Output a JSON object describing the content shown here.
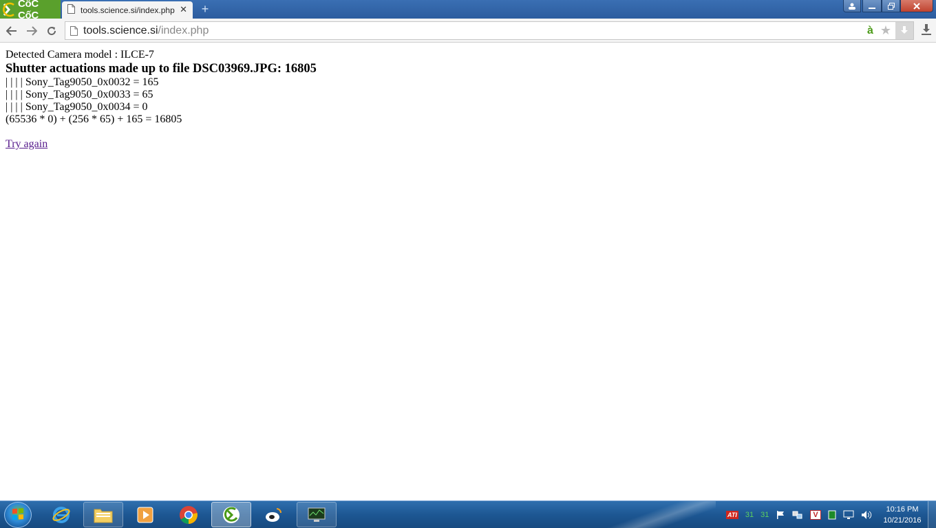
{
  "browser": {
    "brand": "CốC CốC",
    "tab": {
      "title": "tools.science.si/index.php",
      "close": "✕"
    },
    "new_tab": "+",
    "address": {
      "host": "tools.science.si",
      "path": "/index.php",
      "right_badge": "à"
    }
  },
  "page": {
    "camera_line": "Detected Camera model : ILCE-7",
    "heading": "Shutter actuations made up to file DSC03969.JPG: 16805",
    "tags": [
      "| | | | Sony_Tag9050_0x0032 = 165",
      "| | | | Sony_Tag9050_0x0033 = 65",
      "| | | | Sony_Tag9050_0x0034 = 0"
    ],
    "formula": "(65536 * 0) + (256 * 65) + 165 = 16805",
    "try_again": "Try again"
  },
  "taskbar": {
    "items": [
      "internet-explorer",
      "file-explorer",
      "media-player",
      "chrome",
      "coccoc",
      "weibo",
      "system-monitor"
    ],
    "tray": {
      "ati": "ATI",
      "temp1": "31",
      "temp2": "31",
      "v": "V"
    },
    "clock": {
      "time": "10:16 PM",
      "date": "10/21/2016"
    }
  }
}
